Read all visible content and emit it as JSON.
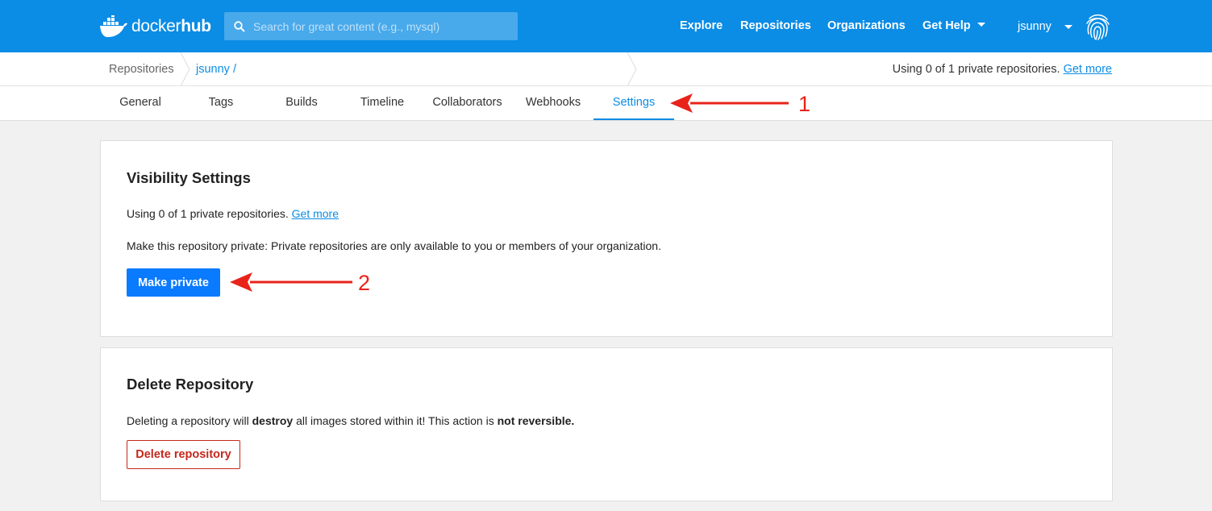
{
  "header": {
    "logo_text_light": "docker",
    "logo_text_bold": "hub",
    "search_placeholder": "Search for great content (e.g., mysql)",
    "nav": [
      {
        "label": "Explore"
      },
      {
        "label": "Repositories"
      },
      {
        "label": "Organizations"
      },
      {
        "label": "Get Help"
      }
    ],
    "username": "jsunny",
    "brand_color": "#0b8ce5"
  },
  "breadcrumb": {
    "root": "Repositories",
    "current": "jsunny /",
    "usage_text": "Using 0 of 1 private repositories.",
    "usage_link": "Get more"
  },
  "tabs": [
    {
      "label": "General",
      "active": false
    },
    {
      "label": "Tags",
      "active": false
    },
    {
      "label": "Builds",
      "active": false
    },
    {
      "label": "Timeline",
      "active": false
    },
    {
      "label": "Collaborators",
      "active": false
    },
    {
      "label": "Webhooks",
      "active": false
    },
    {
      "label": "Settings",
      "active": true
    }
  ],
  "visibility": {
    "title": "Visibility Settings",
    "usage_text": "Using 0 of 1 private repositories.",
    "usage_link": "Get more",
    "description": "Make this repository private: Private repositories are only available to you or members of your organization.",
    "button": "Make private"
  },
  "delete": {
    "title": "Delete Repository",
    "text_1": "Deleting a repository will ",
    "text_bold_1": "destroy",
    "text_2": " all images stored within it! This action is ",
    "text_bold_2": "not reversible.",
    "button": "Delete repository",
    "danger_color": "#c5271d"
  },
  "annotations": {
    "arrow_1_label": "1",
    "arrow_2_label": "2",
    "color": "#e8231a"
  }
}
